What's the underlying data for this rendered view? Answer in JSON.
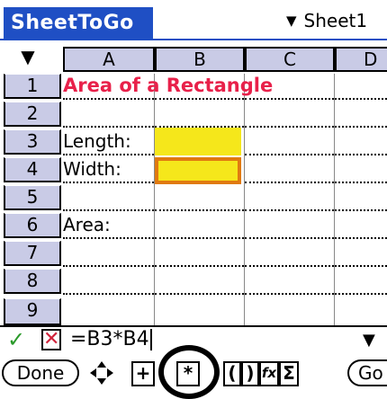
{
  "app": {
    "title": "SheetToGo",
    "sheet_selector": "Sheet1"
  },
  "columns": [
    "A",
    "B",
    "C",
    "D"
  ],
  "rows": [
    {
      "label": "1",
      "a": "Area of a Rectangle"
    },
    {
      "label": "2",
      "a": ""
    },
    {
      "label": "3",
      "a": "Length:"
    },
    {
      "label": "4",
      "a": "Width:"
    },
    {
      "label": "5",
      "a": ""
    },
    {
      "label": "6",
      "a": "Area:"
    },
    {
      "label": "7",
      "a": ""
    },
    {
      "label": "8",
      "a": ""
    },
    {
      "label": "9",
      "a": ""
    }
  ],
  "formula_bar": {
    "formula": "=B3*B4"
  },
  "toolbar": {
    "done_label": "Done",
    "plus": "+",
    "multiply": "*",
    "open_paren": "(",
    "close_paren": ")",
    "function": "fx",
    "sum": "Σ",
    "go_label": "Go"
  },
  "colors": {
    "title_bar": "#1f4fc4",
    "header_fill": "#c9cbe6",
    "highlight": "#f5e71b",
    "selected_border": "#e07a10",
    "title_text": "#e8214a"
  }
}
